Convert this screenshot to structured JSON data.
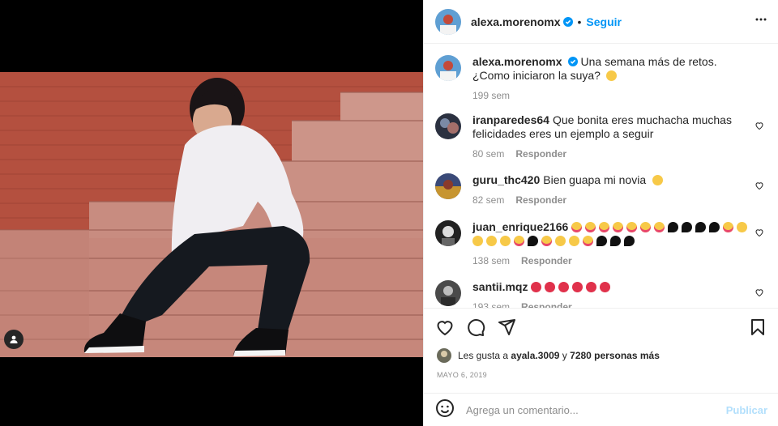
{
  "post": {
    "author": "alexa.morenomx",
    "follow_label": "Seguir",
    "separator": "•",
    "caption_line1": "Una semana más de retos.",
    "caption_line2": "¿Como iniciaron la suya?",
    "caption_time": "199 sem"
  },
  "comments": [
    {
      "user": "iranparedes64",
      "text": "Que bonita eres muchacha muchas felicidades eres un ejemplo a seguir",
      "time": "80 sem",
      "reply": "Responder"
    },
    {
      "user": "guru_thc420",
      "text": "Bien guapa mi novia",
      "time": "82 sem",
      "reply": "Responder"
    },
    {
      "user": "juan_enrique2166",
      "text": "",
      "time": "138 sem",
      "reply": "Responder"
    },
    {
      "user": "santii.mqz",
      "text": "",
      "time": "193 sem",
      "reply": "Responder"
    }
  ],
  "emoji_rows": {
    "c1": [
      "heart-eyes"
    ],
    "c2": [
      "heart-eyes",
      "heart-eyes",
      "heart-eyes",
      "heart-eyes",
      "heart-eyes",
      "heart-eyes",
      "heart-eyes",
      "black-heart",
      "black-heart",
      "black-heart",
      "black-heart",
      "heart-eyes",
      "kiss",
      "kiss",
      "kiss",
      "kiss",
      "heart-eyes",
      "black-heart",
      "heart-eyes",
      "kiss",
      "kiss",
      "heart-eyes",
      "black-heart",
      "black-heart",
      "black-heart"
    ],
    "c3": [
      "rose",
      "rose",
      "rose",
      "rose",
      "rose",
      "rose"
    ]
  },
  "likes": {
    "prefix": "Les gusta a",
    "user": "ayala.3009",
    "conj": "y",
    "count": "7280 personas más"
  },
  "date": "MAYO 6, 2019",
  "composer": {
    "placeholder": "Agrega un comentario...",
    "publish_label": "Publicar"
  },
  "colors": {
    "accent": "#0095f6",
    "verified": "#0095f6",
    "muted": "#8e8e8e",
    "publish_disabled": "#b2dffc"
  },
  "icons": [
    "verified-icon",
    "more-options-icon",
    "heart-icon",
    "comment-icon",
    "share-icon",
    "bookmark-icon",
    "emoji-icon",
    "user-tag-icon"
  ]
}
